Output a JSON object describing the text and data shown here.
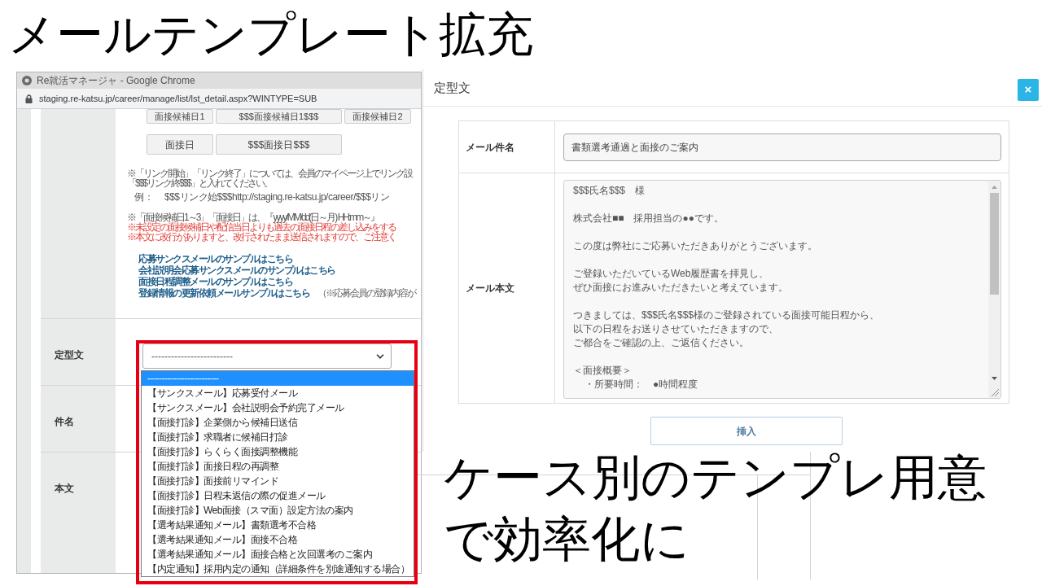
{
  "slide_title": "メールテンプレート拡充",
  "browser": {
    "title": "Re就活マネージャ - Google Chrome",
    "url": "staging.re-katsu.jp/career/manage/list/lst_detail.aspx?WINTYPE=SUB"
  },
  "tag_rows": [
    [
      "面接候補日1",
      "$$$面接候補日1$$$",
      "面接候補日2"
    ],
    [
      "面接日",
      "$$$面接日$$$"
    ]
  ],
  "notes": [
    {
      "kind": "text",
      "lines": [
        {
          "text": "※「リンク開始」「リンク終了」については、会員のマイページ上でリンク設",
          "warning": false
        },
        {
          "text": "「$$$リンク終$$$」と入れてください。",
          "warning": false
        }
      ]
    },
    {
      "kind": "example",
      "label": "例：",
      "text": "$$$リンク始$$$http://staging.re-katsu.jp/career/$$$リン"
    },
    {
      "kind": "text",
      "lines": [
        {
          "text": "※「面接候補日1～3」「面接日」は、『yyyy/MM/dd(日～月) HH:mm～』",
          "warning": false
        },
        {
          "text": "※未設定の面接候補日や配信当日よりも過去の面接日程の差し込みをする",
          "warning": true
        },
        {
          "text": "※本文に改行がありますと、改行されたまま送信されますので、ご注意く",
          "warning": true
        }
      ]
    }
  ],
  "sample_links": [
    {
      "text": "応募サンクスメールのサンプルはこちら"
    },
    {
      "text": "会社説明会応募サンクスメールのサンプルはこちら"
    },
    {
      "text": "面接日程調整メールのサンプルはこちら"
    },
    {
      "text": "登録情報の更新依頼メールサンプルはこちら",
      "note": "（※応募会員の登録内容が"
    }
  ],
  "form_rows": [
    {
      "label": "定型文",
      "select": {
        "value": "-------------------------",
        "options": [
          {
            "label": "-------------------------",
            "selected": true
          },
          {
            "label": "【サンクスメール】応募受付メール",
            "selected": false
          },
          {
            "label": "【サンクスメール】会社説明会予約完了メール",
            "selected": false
          },
          {
            "label": "【面接打診】企業側から候補日送信",
            "selected": false
          },
          {
            "label": "【面接打診】求職者に候補日打診",
            "selected": false
          },
          {
            "label": "【面接打診】らくらく面接調整機能",
            "selected": false
          },
          {
            "label": "【面接打診】面接日程の再調整",
            "selected": false
          },
          {
            "label": "【面接打診】面接前リマインド",
            "selected": false
          },
          {
            "label": "【面接打診】日程未返信の際の促進メール",
            "selected": false
          },
          {
            "label": "【面接打診】Web面接（スマ面）設定方法の案内",
            "selected": false
          },
          {
            "label": "【選考結果通知メール】書類選考不合格",
            "selected": false
          },
          {
            "label": "【選考結果通知メール】面接不合格",
            "selected": false
          },
          {
            "label": "【選考結果通知メール】面接合格と次回選考のご案内",
            "selected": false
          },
          {
            "label": "【内定通知】採用内定の通知（詳細条件を別途通知する場合）",
            "selected": false
          }
        ]
      }
    },
    {
      "label": "件名"
    },
    {
      "label": "本文"
    }
  ],
  "modal": {
    "title": "定型文",
    "close_label": "×",
    "fields": [
      {
        "kind": "input",
        "label": "メール件名",
        "value": "書類選考通過と面接のご案内"
      },
      {
        "kind": "textarea",
        "label": "メール本文",
        "paragraphs": [
          [
            "$$$氏名$$$　様"
          ],
          [
            "株式会社■■　採用担当の●●です。"
          ],
          [
            "この度は弊社にご応募いただきありがとうございます。"
          ],
          [
            "ご登録いただいているWeb履歴書を拝見し、",
            "ぜひ面接にお進みいただきたいと考えています。"
          ],
          [
            "つきましては、$$$氏名$$$様のご登録されている面接可能日程から、",
            "以下の日程をお送りさせていただきますので、",
            "ご都合をご確認の上、ご返信ください。"
          ]
        ],
        "overview": {
          "heading": "＜面接概要＞",
          "items": [
            "・所要時間：　●時間程度"
          ]
        }
      }
    ],
    "insert_button": "挿入"
  },
  "caption": "ケース別のテンプレ用意で効率化に"
}
